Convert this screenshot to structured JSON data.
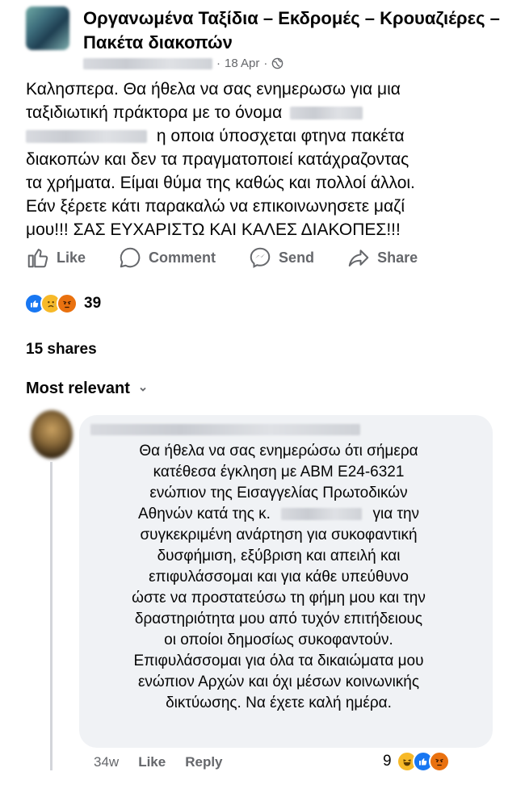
{
  "post": {
    "group_name": "Οργανωμένα Ταξίδια – Εκδρομές – Κρουαζιέρες – Πακέτα διακοπών",
    "date": "18 Apr",
    "separator": "·",
    "text_line1": "Καλησπερα. Θα ήθελα να σας ενημερωσω για μια",
    "text_line2": "ταξιδιωτική πράκτορα με το όνομα",
    "text_line3": "η οποια ύποσχεται φτηνα πακέτα",
    "text_line4": "διακοπών και δεν τα πραγματοποιεί κατάχραζοντας",
    "text_line5": "τα χρήματα. Είμαι θύμα της καθώς και πολλοί άλλοι.",
    "text_line6": "Εάν ξέρετε κάτι παρακαλώ να επικοινωνησετε μαζί",
    "text_line7": "μου!!! ΣΑΣ ΕΥΧΑΡΙΣΤΩ ΚΑΙ ΚΑΛΕΣ ΔΙΑΚΟΠΕΣ!!!"
  },
  "actions": {
    "like": "Like",
    "comment": "Comment",
    "send": "Send",
    "share": "Share"
  },
  "reactions": {
    "count": "39",
    "icons": [
      "like-icon",
      "sad-icon",
      "angry-icon"
    ],
    "colors": {
      "like": "#1877f2",
      "sad": "#f7b928",
      "angry": "#e9710f"
    }
  },
  "shares_label": "15 shares",
  "sort_label": "Most relevant",
  "comment": {
    "line1": "Θα ήθελα να σας ενημερώσω ότι σήμερα",
    "line2": "κατέθεσα έγκληση  με ΑΒΜ Ε24-6321",
    "line3": "ενώπιον της Εισαγγελίας Πρωτοδικών",
    "line4a": "Αθηνών κατά της κ.",
    "line4b": "για την",
    "line5": "συγκεκριμένη ανάρτηση για συκοφαντική",
    "line6": "δυσφήμιση, εξύβριση και απειλή και",
    "line7": "επιφυλάσσομαι και για κάθε υπεύθυνο",
    "line8": "ώστε να προστατεύσω τη φήμη μου και την",
    "line9": "δραστηριότητα μου από τυχόν επιτήδειους",
    "line10": "οι οποίοι δημοσίως συκοφαντούν.",
    "line11": "Επιφυλάσσομαι για όλα τα δικαιώματα μου",
    "line12": "ενώπιον Αρχών και όχι μέσων κοινωνικής",
    "line13": "δικτύωσης. Να έχετε καλή ημέρα.",
    "age": "34w",
    "like": "Like",
    "reply": "Reply",
    "reaction_count": "9"
  }
}
